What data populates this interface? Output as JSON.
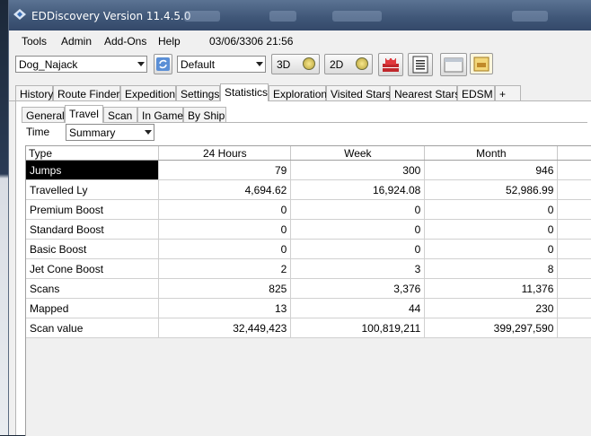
{
  "window": {
    "title": "EDDiscovery Version 11.4.5.0"
  },
  "menu": {
    "items": [
      "Tools",
      "Admin",
      "Add-Ons",
      "Help"
    ],
    "datetime": "03/06/3306 21:56"
  },
  "toolbar": {
    "commander": "Dog_Najack",
    "map_profile": "Default",
    "btn_3d": "3D",
    "btn_2d": "2D"
  },
  "tabs": [
    "History",
    "Route Finder",
    "Expedition",
    "Settings",
    "Statistics",
    "Exploration",
    "Visited Stars",
    "Nearest Stars",
    "EDSM",
    "+"
  ],
  "subtabs": [
    "General",
    "Travel",
    "Scan",
    "In Game",
    "By Ship"
  ],
  "time": {
    "label": "Time",
    "value": "Summary"
  },
  "grid": {
    "columns": [
      "Type",
      "24 Hours",
      "Week",
      "Month"
    ],
    "rows": [
      {
        "type": "Jumps",
        "h24": "79",
        "week": "300",
        "month": "946"
      },
      {
        "type": "Travelled Ly",
        "h24": "4,694.62",
        "week": "16,924.08",
        "month": "52,986.99"
      },
      {
        "type": "Premium Boost",
        "h24": "0",
        "week": "0",
        "month": "0"
      },
      {
        "type": "Standard Boost",
        "h24": "0",
        "week": "0",
        "month": "0"
      },
      {
        "type": "Basic Boost",
        "h24": "0",
        "week": "0",
        "month": "0"
      },
      {
        "type": "Jet Cone Boost",
        "h24": "2",
        "week": "3",
        "month": "8"
      },
      {
        "type": "Scans",
        "h24": "825",
        "week": "3,376",
        "month": "11,376"
      },
      {
        "type": "Mapped",
        "h24": "13",
        "week": "44",
        "month": "230"
      },
      {
        "type": "Scan value",
        "h24": "32,449,423",
        "week": "100,819,211",
        "month": "399,297,590"
      }
    ]
  }
}
